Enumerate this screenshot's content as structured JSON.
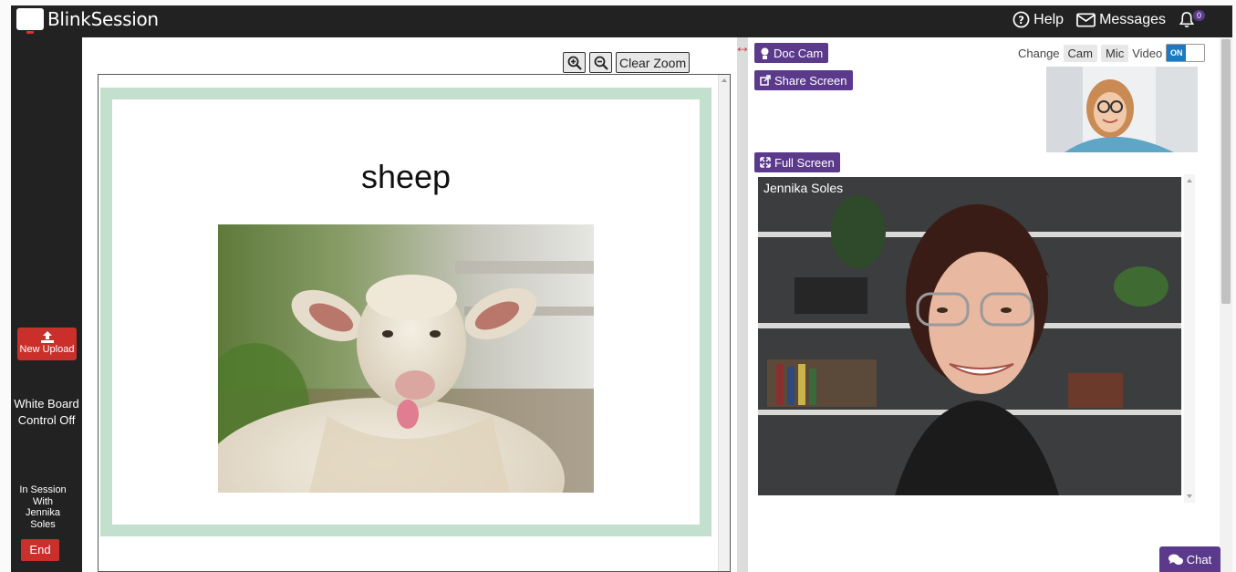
{
  "app": {
    "brand": "BlinkSession",
    "help_label": "Help",
    "messages_label": "Messages",
    "notification_count": "0"
  },
  "sidebar": {
    "upload_label": "New Upload",
    "whiteboard_line1": "White Board",
    "whiteboard_line2": "Control Off",
    "session_line1": "In Session",
    "session_line2": "With",
    "session_line3": "Jennika",
    "session_line4": "Soles",
    "end_label": "End"
  },
  "whiteboard": {
    "zoom_in_icon": "zoom-in-icon",
    "zoom_out_icon": "zoom-out-icon",
    "clear_zoom_label": "Clear Zoom",
    "card_word": "sheep",
    "card_border_color": "#c2e0cd"
  },
  "video": {
    "doc_cam_label": "Doc Cam",
    "share_screen_label": "Share Screen",
    "full_screen_label": "Full Screen",
    "change_label": "Change",
    "cam_label": "Cam",
    "mic_label": "Mic",
    "video_label": "Video",
    "video_toggle_state": "ON",
    "remote_name": "Jennika Soles",
    "chat_label": "Chat"
  },
  "colors": {
    "topbar": "#222222",
    "accent_purple": "#5b3a8c",
    "danger_red": "#c9302c",
    "toggle_blue": "#1a7bc1"
  }
}
